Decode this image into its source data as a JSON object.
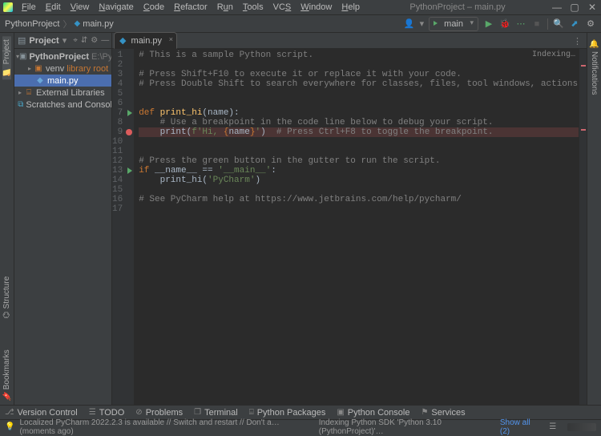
{
  "titlebar": {
    "menus": [
      "File",
      "Edit",
      "View",
      "Navigate",
      "Code",
      "Refactor",
      "Run",
      "Tools",
      "VCS",
      "Window",
      "Help"
    ],
    "title": "PythonProject – main.py",
    "minimize": "—",
    "maximize": "▢",
    "close": "✕"
  },
  "navbar": {
    "crumb1": "PythonProject",
    "crumb2": "main.py",
    "user_icon": "👤",
    "runcfg": "main",
    "icons": {
      "play": "▶",
      "debug": "🐞",
      "rerun": "↻",
      "stop": "■",
      "search": "🔍",
      "updates": "⬆",
      "settings": "⚙"
    }
  },
  "leftstrip": {
    "project": "Project",
    "structure": "Structure",
    "bookmarks": "Bookmarks"
  },
  "rightstrip": {
    "notifications": "Notifications"
  },
  "project_panel": {
    "title": "Project",
    "hdr_icons": {
      "dropdown": "▾",
      "target": "⌖",
      "expand": "⇵",
      "settings": "⚙",
      "hide": "—"
    },
    "root": {
      "name": "PythonProject",
      "path": "E:\\PythonProject"
    },
    "venv": {
      "name": "venv",
      "hint": "library root"
    },
    "mainfile": "main.py",
    "extlib": "External Libraries",
    "scratches": "Scratches and Consoles"
  },
  "tabs": {
    "main": {
      "label": "main.py",
      "close": "×"
    },
    "kebab": "⋮"
  },
  "editor": {
    "indexing": "Indexing…",
    "lines": [
      {
        "n": "1",
        "type": "cmt",
        "text": "# This is a sample Python script."
      },
      {
        "n": "2",
        "type": "blank"
      },
      {
        "n": "3",
        "type": "cmt",
        "text": "# Press Shift+F10 to execute it or replace it with your code."
      },
      {
        "n": "4",
        "type": "cmt",
        "text": "# Press Double Shift to search everywhere for classes, files, tool windows, actions, and settings."
      },
      {
        "n": "5",
        "type": "blank"
      },
      {
        "n": "6",
        "type": "blank"
      },
      {
        "n": "7",
        "type": "def",
        "kw": "def ",
        "fn": "print_hi",
        "rest": "(name):"
      },
      {
        "n": "8",
        "type": "cmt",
        "indent": "    ",
        "text": "# Use a breakpoint in the code line below to debug your script."
      },
      {
        "n": "9",
        "type": "print",
        "indent": "    ",
        "call": "print",
        "s1": "(",
        "s2": "f'Hi, ",
        "br1": "{",
        "var": "name",
        "br2": "}",
        "s3": "'",
        "s4": ")",
        "tail": "  # Press Ctrl+F8 to toggle the breakpoint."
      },
      {
        "n": "10",
        "type": "blank"
      },
      {
        "n": "11",
        "type": "blank"
      },
      {
        "n": "12",
        "type": "cmt",
        "text": "# Press the green button in the gutter to run the script."
      },
      {
        "n": "13",
        "type": "if",
        "kw": "if ",
        "id": "__name__",
        "eq": " == ",
        "str": "'__main__'",
        "colon": ":"
      },
      {
        "n": "14",
        "type": "call",
        "indent": "    ",
        "fn": "print_hi",
        "s1": "(",
        "str": "'PyCharm'",
        "s2": ")"
      },
      {
        "n": "15",
        "type": "blank"
      },
      {
        "n": "16",
        "type": "cmt",
        "text": "# See PyCharm help at https://www.jetbrains.com/help/pycharm/"
      },
      {
        "n": "17",
        "type": "blank"
      }
    ]
  },
  "bottom": {
    "version_control": "Version Control",
    "todo": "TODO",
    "problems": "Problems",
    "terminal": "Terminal",
    "py_packages": "Python Packages",
    "py_console": "Python Console",
    "services": "Services"
  },
  "status": {
    "msg": "Localized PyCharm 2022.2.3 is available // Switch and restart // Don't a… (moments ago)",
    "indexing": "Indexing Python SDK 'Python 3.10 (PythonProject)'…",
    "showall": "Show all (2)",
    "caret": "☰"
  }
}
